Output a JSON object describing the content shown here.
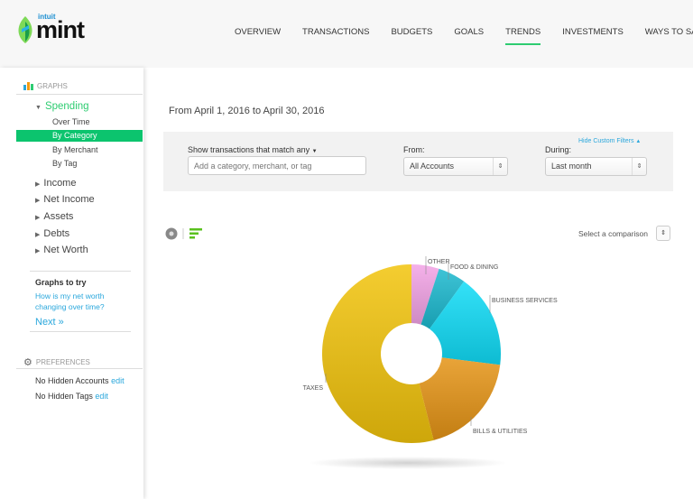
{
  "header": {
    "logo_small": "intuit",
    "logo": "mint",
    "nav": [
      {
        "label": "OVERVIEW"
      },
      {
        "label": "TRANSACTIONS"
      },
      {
        "label": "BUDGETS"
      },
      {
        "label": "GOALS"
      },
      {
        "label": "TRENDS",
        "active": true
      },
      {
        "label": "INVESTMENTS"
      },
      {
        "label": "WAYS TO SAVE"
      }
    ]
  },
  "sidebar": {
    "graphs_heading": "GRAPHS",
    "spending": "Spending",
    "spending_sub": [
      "Over Time",
      "By Category",
      "By Merchant",
      "By Tag"
    ],
    "active_sub": "By Category",
    "items": [
      "Income",
      "Net Income",
      "Assets",
      "Debts",
      "Net Worth"
    ],
    "graphs_to_try": "Graphs to try",
    "try_link": "How is my net worth changing over time?",
    "next": "Next »",
    "preferences_heading": "PREFERENCES",
    "hidden_accounts": "No Hidden Accounts",
    "hidden_tags": "No Hidden Tags",
    "edit": "edit"
  },
  "main": {
    "date_range": "From April 1, 2016 to April 30, 2016",
    "filters": {
      "match_label": "Show transactions that match",
      "match_value": "any",
      "search_placeholder": "Add a category, merchant, or tag",
      "from_label": "From:",
      "from_value": "All Accounts",
      "during_label": "During:",
      "during_value": "Last month",
      "hide_filters": "Hide Custom Filters"
    },
    "comparison": "Select a comparison"
  },
  "colors": {
    "accent": "#0cc46e",
    "link": "#2aa7dc"
  },
  "chart_data": {
    "type": "pie",
    "donut": true,
    "categories": [
      "OTHER",
      "FOOD & DINING",
      "BUSINESS SERVICES",
      "BILLS & UTILITIES",
      "TAXES"
    ],
    "values": [
      5,
      5,
      17,
      19,
      54
    ],
    "colors": [
      "#f3a3e6",
      "#1cb9cf",
      "#10dcf7",
      "#e59416",
      "#f2c40c"
    ]
  }
}
